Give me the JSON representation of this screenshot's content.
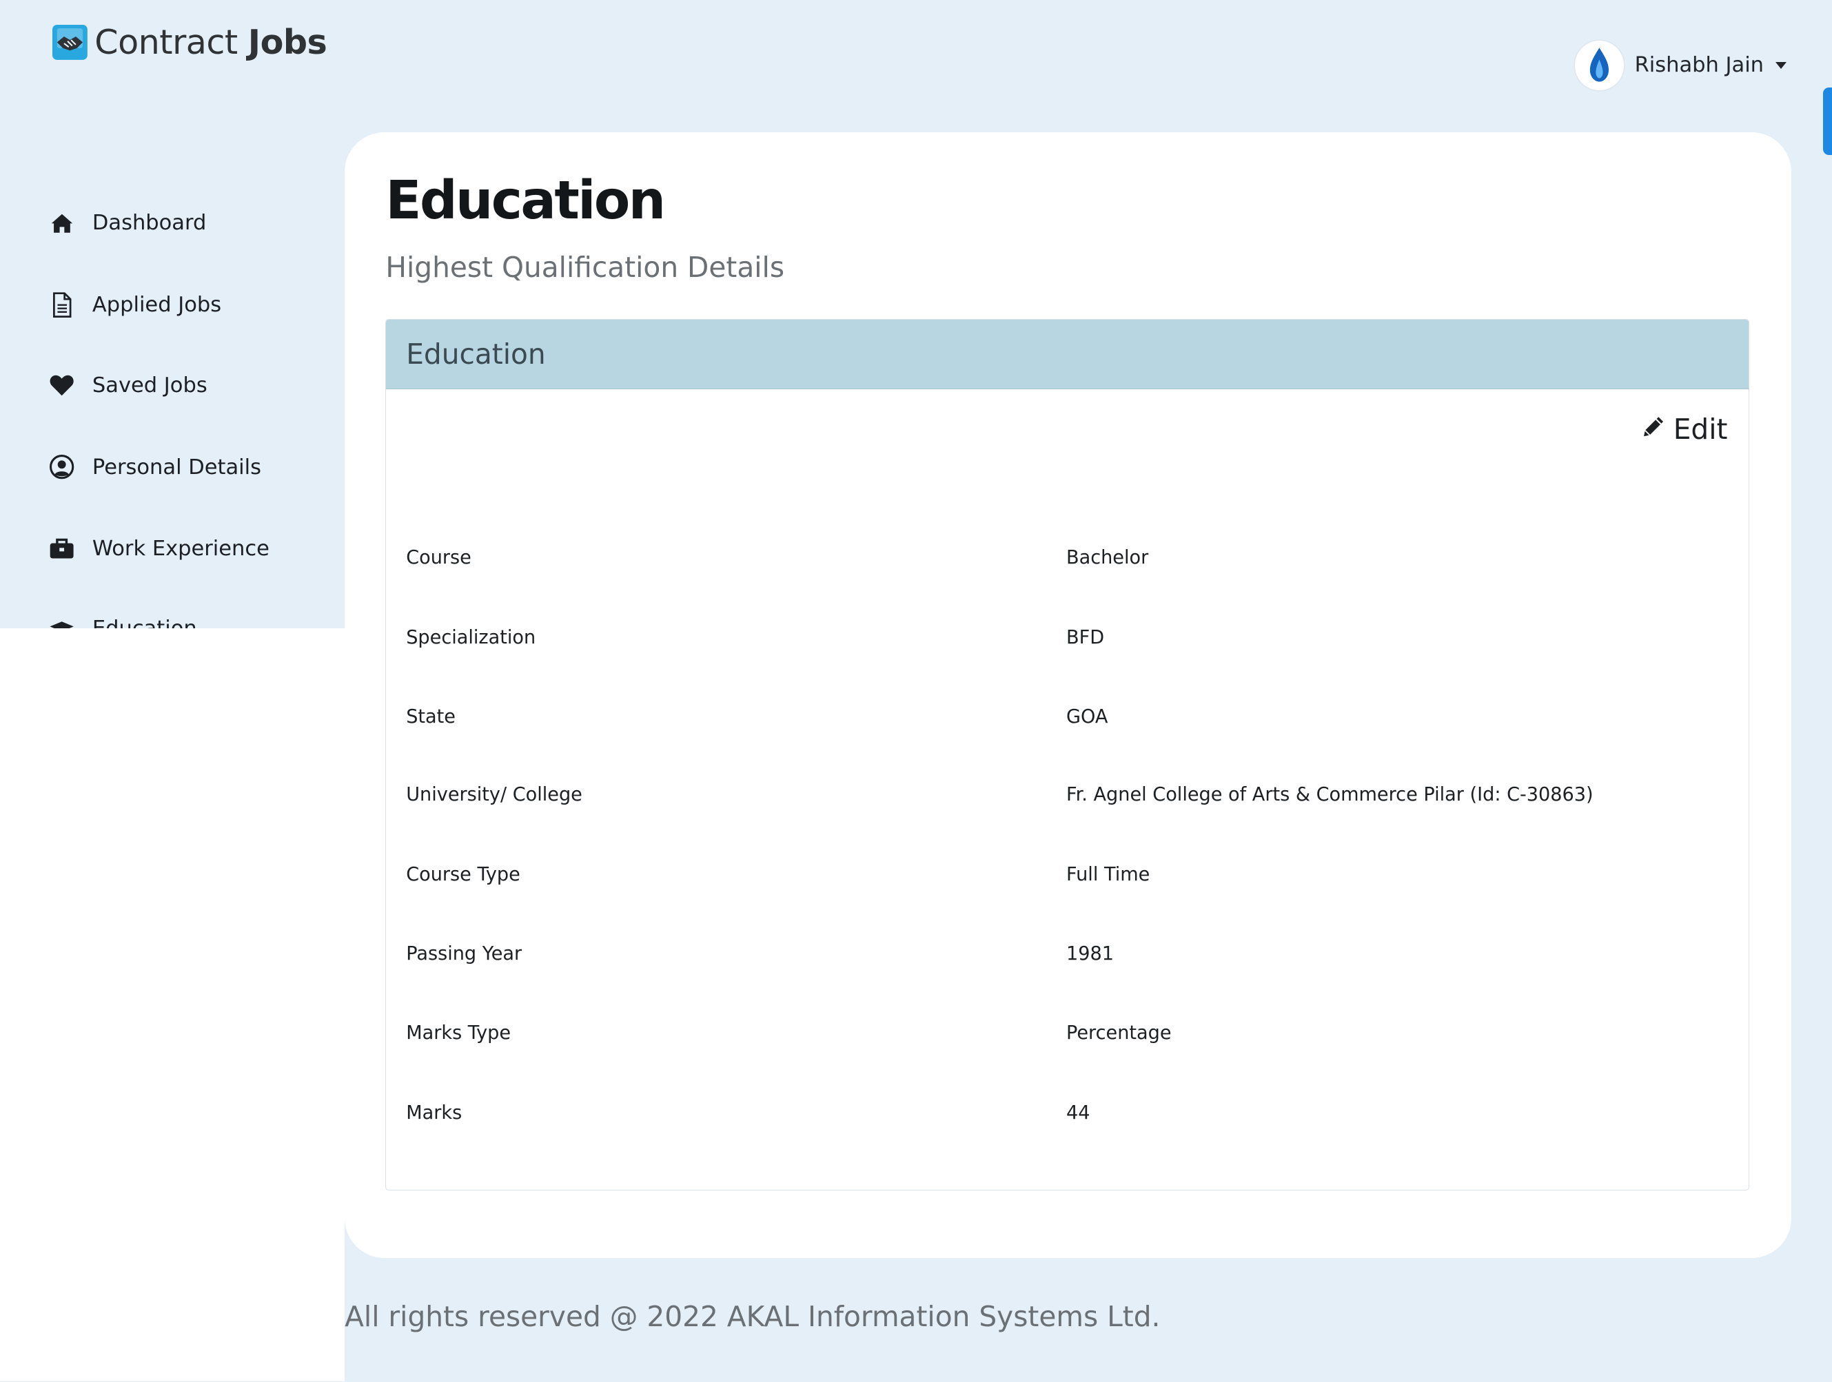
{
  "brand": {
    "name_part1": "Contract ",
    "name_part2": "Jobs",
    "logo_icon": "handshake-icon"
  },
  "user": {
    "name": "Rishabh Jain"
  },
  "sidebar": {
    "items": [
      {
        "label": "Dashboard",
        "icon": "home-icon"
      },
      {
        "label": "Applied Jobs",
        "icon": "document-icon"
      },
      {
        "label": "Saved Jobs",
        "icon": "heart-icon"
      },
      {
        "label": "Personal Details",
        "icon": "user-circle-icon"
      },
      {
        "label": "Work Experience",
        "icon": "briefcase-icon"
      },
      {
        "label": "Education",
        "icon": "graduation-cap-icon"
      }
    ]
  },
  "page": {
    "title": "Education",
    "subtitle": "Highest Qualification Details"
  },
  "panel": {
    "title": "Education",
    "edit_label": "Edit",
    "fields": [
      {
        "label": "Course",
        "value": "Bachelor"
      },
      {
        "label": "Specialization",
        "value": "BFD"
      },
      {
        "label": "State",
        "value": "GOA"
      },
      {
        "label": "University/ College",
        "value": "Fr. Agnel College of Arts & Commerce Pilar (Id: C-30863)"
      },
      {
        "label": "Course Type",
        "value": "Full Time"
      },
      {
        "label": "Passing Year",
        "value": "1981"
      },
      {
        "label": "Marks Type",
        "value": "Percentage"
      },
      {
        "label": "Marks",
        "value": "44"
      }
    ]
  },
  "footer": {
    "text": "All rights reserved @ 2022 AKAL Information Systems Ltd."
  },
  "colors": {
    "background": "#e4eff8",
    "panel_header": "#b8d6e1",
    "accent": "#1e88e5"
  }
}
